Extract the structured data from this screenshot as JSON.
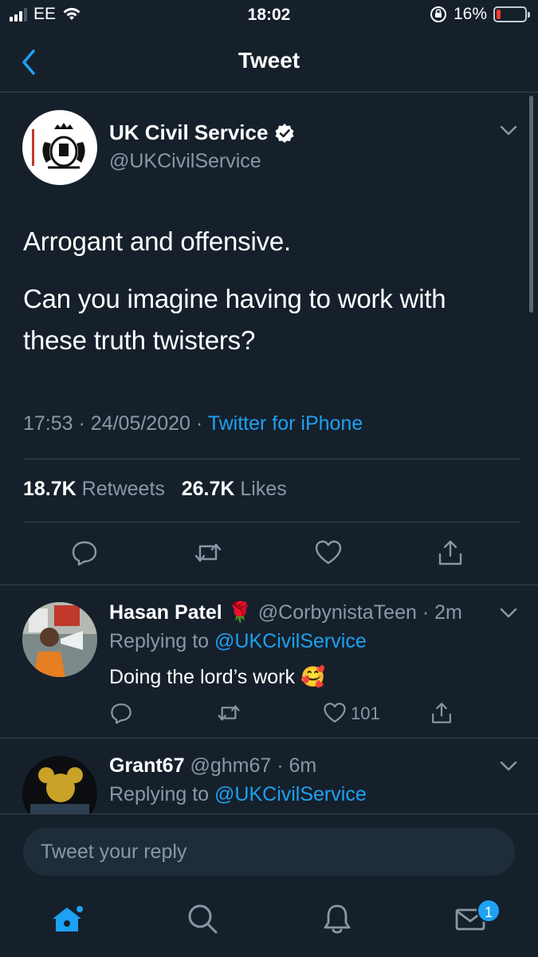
{
  "status_bar": {
    "carrier": "EE",
    "time": "18:02",
    "battery_percent": "16%",
    "battery_level": 0.16,
    "icons": [
      "signal-icon",
      "wifi-icon",
      "orientation-lock-icon",
      "battery-icon"
    ]
  },
  "nav": {
    "title": "Tweet",
    "back_icon": "chevron-left-icon"
  },
  "main_tweet": {
    "author_name": "UK Civil Service",
    "author_handle": "@UKCivilService",
    "verified": true,
    "text_lines": [
      "Arrogant and offensive.",
      "Can you imagine having to work with these truth twisters?"
    ],
    "time": "17:53",
    "date": "24/05/2020",
    "source": "Twitter for iPhone",
    "retweets_count": "18.7K",
    "retweets_label": "Retweets",
    "likes_count": "26.7K",
    "likes_label": "Likes"
  },
  "replies": [
    {
      "name": "Hasan Patel",
      "emoji": "🌹",
      "handle": "@CorbynistaTeen",
      "time": "2m",
      "replying_label": "Replying to",
      "replying_to": "@UKCivilService",
      "text": "Doing the lord’s work",
      "text_emoji": "🥰",
      "like_count": "101"
    },
    {
      "name": "Grant67",
      "handle": "@ghm67",
      "time": "6m",
      "replying_label": "Replying to",
      "replying_to": "@UKCivilService"
    }
  ],
  "reply_box": {
    "placeholder": "Tweet your reply"
  },
  "tabbar": {
    "items": [
      "home-icon",
      "search-icon",
      "notifications-icon",
      "messages-icon"
    ],
    "messages_badge": "1"
  },
  "colors": {
    "background": "#15202b",
    "accent": "#1da1f2",
    "muted": "#8899a6",
    "divider": "#38444d"
  }
}
